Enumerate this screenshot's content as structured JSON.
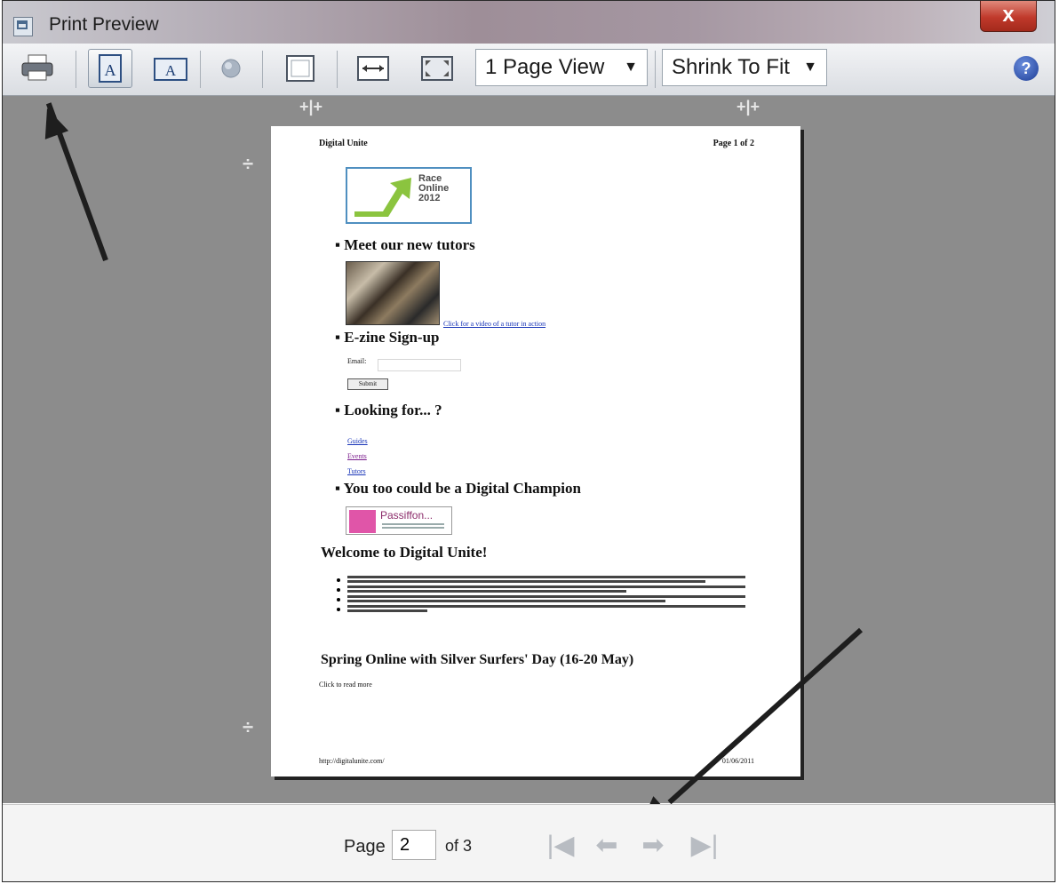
{
  "window": {
    "title": "Print Preview",
    "close_label": "x",
    "help_label": "?"
  },
  "toolbar": {
    "buttons": [
      {
        "icon": "printer-icon"
      },
      {
        "icon": "portrait-icon",
        "label": "A"
      },
      {
        "icon": "landscape-icon",
        "label": "A"
      },
      {
        "icon": "headers-footers-icon"
      },
      {
        "icon": "page-setup-icon"
      },
      {
        "icon": "full-width-icon"
      },
      {
        "icon": "full-page-icon"
      }
    ],
    "view_dropdown": "1 Page View",
    "size_dropdown": "Shrink To Fit"
  },
  "page": {
    "header_left": "Digital Unite",
    "header_right": "Page 1 of 2",
    "logo_lines": [
      "Race",
      "Online",
      "2012"
    ],
    "headings": [
      "Meet our new tutors",
      "E-zine Sign-up",
      "Looking for... ?",
      "You too could be a Digital Champion"
    ],
    "photo_link": "Click for a video of a tutor in action",
    "signup_label": "Email:",
    "signup_button": "Submit",
    "links": [
      "Guides",
      "Events",
      "Tutors"
    ],
    "passion_text": "Passiffon...",
    "welcome_heading": "Welcome to Digital Unite!",
    "spring_heading": "Spring Online with Silver Surfers' Day (16-20 May)",
    "spring_text": "Click to read more",
    "footer_left": "http://digitalunite.com/",
    "footer_right": "01/06/2011"
  },
  "pager": {
    "label": "Page",
    "current": "2",
    "of": "of 3"
  },
  "colors": {
    "preview_bg": "#8c8c8c",
    "link": "#1a36b8",
    "close_red": "#c0392b"
  }
}
